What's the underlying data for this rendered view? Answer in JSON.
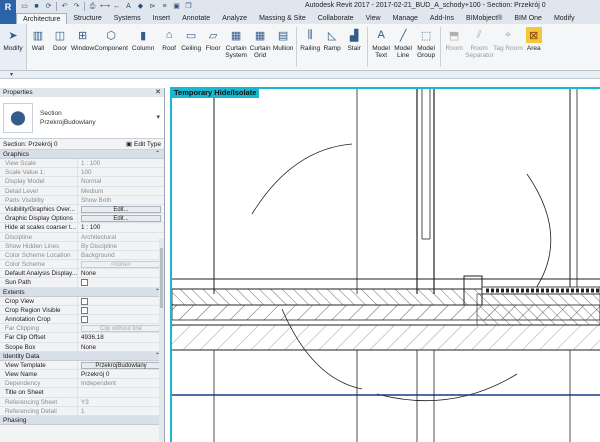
{
  "window": {
    "title": "Autodesk Revit 2017 -   2017-02-21_BUD_A_schody+100 - Section: Przekrój 0",
    "app_logo": "R"
  },
  "quick_access": [
    "open-icon",
    "save-icon",
    "sync-icon",
    "undo-icon",
    "redo-icon",
    "print-icon",
    "measure-icon",
    "dimension-icon",
    "text-icon",
    "3d-view-icon",
    "section-icon",
    "thin-lines-icon",
    "close-hidden-icon",
    "switch-windows-icon"
  ],
  "tabs": [
    {
      "label": "Architecture",
      "active": true
    },
    {
      "label": "Structure"
    },
    {
      "label": "Systems"
    },
    {
      "label": "Insert"
    },
    {
      "label": "Annotate"
    },
    {
      "label": "Analyze"
    },
    {
      "label": "Massing & Site"
    },
    {
      "label": "Collaborate"
    },
    {
      "label": "View"
    },
    {
      "label": "Manage"
    },
    {
      "label": "Add-Ins"
    },
    {
      "label": "BIMobject®"
    },
    {
      "label": "BIM One"
    },
    {
      "label": "Modify"
    }
  ],
  "ribbon": {
    "modify": "Modify",
    "build": [
      "Wall",
      "Door",
      "Window",
      "Component",
      "Column",
      "Roof",
      "Ceiling",
      "Floor",
      "Curtain System",
      "Curtain Grid",
      "Mullion"
    ],
    "circulation": [
      "Railing",
      "Ramp",
      "Stair"
    ],
    "model": [
      "Model Text",
      "Model Line",
      "Model Group"
    ],
    "room": [
      "Room",
      "Room Separator",
      "Tag Room",
      "Area"
    ]
  },
  "properties": {
    "title": "Properties",
    "family": "Section",
    "type": "PrzekrojBudowlany",
    "instance": "Section: Przekrój 0",
    "edit_type": "Edit Type",
    "groups": {
      "graphics": "Graphics",
      "extents": "Extents",
      "identity": "Identity Data",
      "phasing": "Phasing"
    },
    "graphics_rows": [
      {
        "k": "View Scale",
        "v": "1 : 100",
        "gray": true
      },
      {
        "k": "Scale Value    1:",
        "v": "100",
        "gray": true
      },
      {
        "k": "Display Model",
        "v": "Normal",
        "gray": true
      },
      {
        "k": "Detail Level",
        "v": "Medium",
        "gray": true
      },
      {
        "k": "Parts Visibility",
        "v": "Show Both",
        "gray": true
      },
      {
        "k": "Visibility/Graphics Over...",
        "v": "Edit...",
        "button": true
      },
      {
        "k": "Graphic Display Options",
        "v": "Edit...",
        "button": true
      },
      {
        "k": "Hide at scales coarser t...",
        "v": "1 : 100"
      },
      {
        "k": "Discipline",
        "v": "Architectural",
        "gray": true
      },
      {
        "k": "Show Hidden Lines",
        "v": "By Discipline",
        "gray": true
      },
      {
        "k": "Color Scheme Location",
        "v": "Background",
        "gray": true
      },
      {
        "k": "Color Scheme",
        "v": "<none>",
        "button": true,
        "gray": true
      },
      {
        "k": "Default Analysis Display...",
        "v": "None"
      },
      {
        "k": "Sun Path",
        "v": "",
        "check": true
      }
    ],
    "extents_rows": [
      {
        "k": "Crop View",
        "v": "",
        "check": true
      },
      {
        "k": "Crop Region Visible",
        "v": "",
        "check": true
      },
      {
        "k": "Annotation Crop",
        "v": "",
        "check": true
      },
      {
        "k": "Far Clipping",
        "v": "Clip without line",
        "button": true,
        "gray": true
      },
      {
        "k": "Far Clip Offset",
        "v": "4936,18"
      },
      {
        "k": "Scope Box",
        "v": "None"
      }
    ],
    "identity_rows": [
      {
        "k": "View Template",
        "v": "PrzekrojBudowlany",
        "button": true
      },
      {
        "k": "View Name",
        "v": "Przekrój 0"
      },
      {
        "k": "Dependency",
        "v": "Independent",
        "gray": true
      },
      {
        "k": "Title on Sheet",
        "v": ""
      },
      {
        "k": "Referencing Sheet",
        "v": "Y3",
        "gray": true
      },
      {
        "k": "Referencing Detail",
        "v": "1",
        "gray": true
      }
    ]
  },
  "canvas": {
    "banner": "Temporary Hide/Isolate",
    "frame_color": "#18b8d2"
  }
}
